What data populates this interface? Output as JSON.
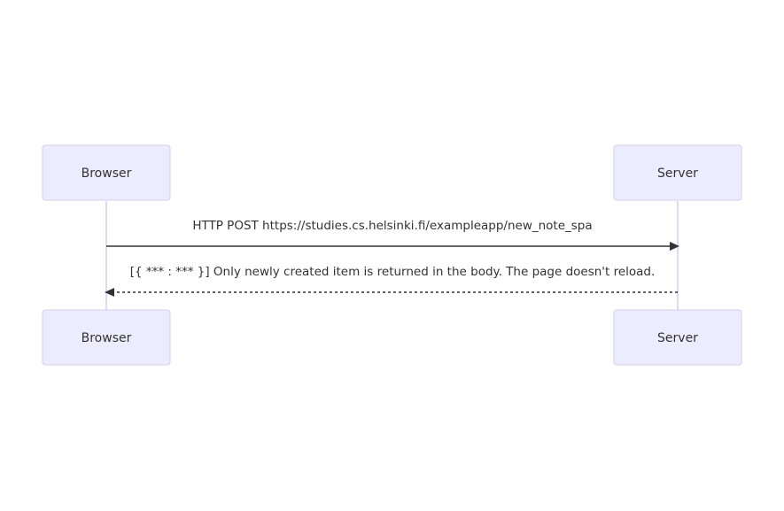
{
  "participants": {
    "browser": "Browser",
    "server": "Server"
  },
  "messages": [
    {
      "from": "Browser",
      "to": "Server",
      "text": "HTTP POST https://studies.cs.helsinki.fi/exampleapp/new_note_spa",
      "style": "solid"
    },
    {
      "from": "Server",
      "to": "Browser",
      "text": "[{ *** : *** }] Only newly created item is returned in the body. The page doesn't reload.",
      "style": "dashed"
    }
  ],
  "colors": {
    "actor_fill": "#ECECFF",
    "actor_border": "#CFCFF0",
    "lifeline": "#CFCFEF",
    "text": "#333333"
  }
}
